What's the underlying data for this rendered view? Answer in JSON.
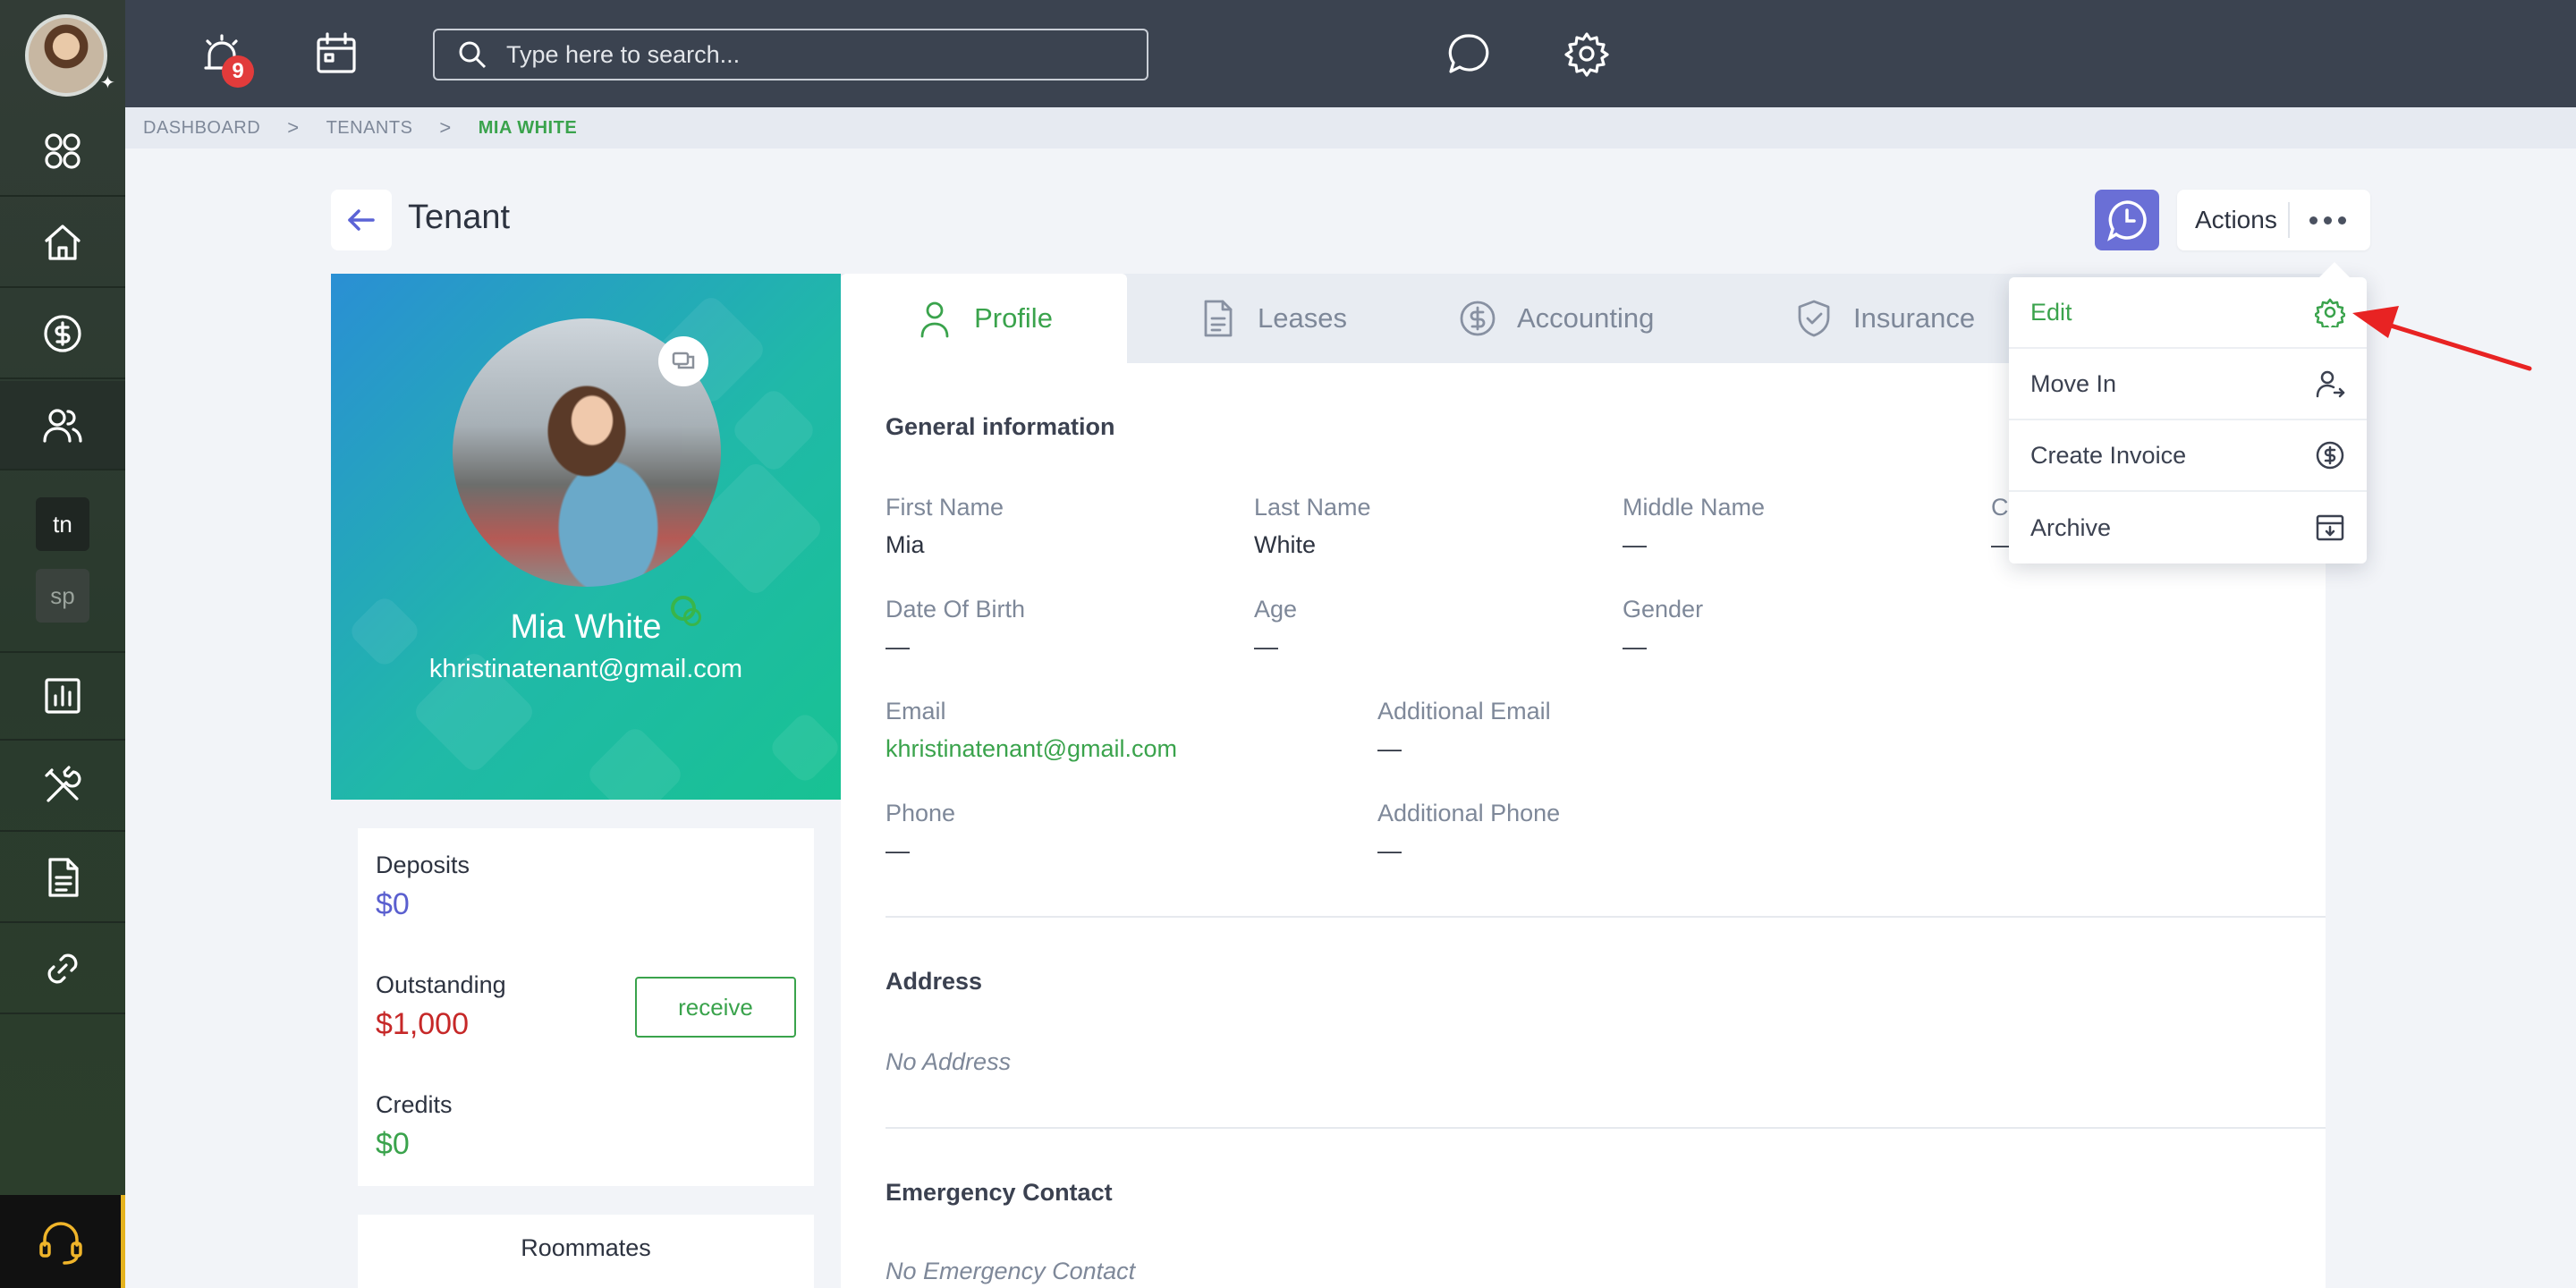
{
  "topbar": {
    "notification_count": "9",
    "search_placeholder": "Type here to search..."
  },
  "breadcrumb": {
    "items": [
      "DASHBOARD",
      "TENANTS"
    ],
    "current": "MIA WHITE",
    "separator": ">"
  },
  "header": {
    "title": "Tenant",
    "actions_label": "Actions"
  },
  "sidebar": {
    "chips": [
      "tn",
      "sp"
    ],
    "icons": [
      "apps-icon",
      "home-icon",
      "dollar-icon",
      "people-icon",
      "chart-icon",
      "tools-icon",
      "document-icon",
      "link-icon",
      "headset-icon"
    ]
  },
  "profile": {
    "name": "Mia White",
    "email": "khristinatenant@gmail.com"
  },
  "balances": {
    "deposits_label": "Deposits",
    "deposits_value": "$0",
    "outstanding_label": "Outstanding",
    "outstanding_value": "$1,000",
    "credits_label": "Credits",
    "credits_value": "$0",
    "receive_label": "receive",
    "roommates_label": "Roommates"
  },
  "tabs": [
    {
      "label": "Profile",
      "active": true
    },
    {
      "label": "Leases",
      "active": false
    },
    {
      "label": "Accounting",
      "active": false
    },
    {
      "label": "Insurance",
      "active": false
    }
  ],
  "general": {
    "title": "General information",
    "first_name_label": "First Name",
    "first_name": "Mia",
    "last_name_label": "Last Name",
    "last_name": "White",
    "middle_name_label": "Middle Name",
    "middle_name": "—",
    "partial_label": "C",
    "partial_value": "—",
    "dob_label": "Date Of Birth",
    "dob": "—",
    "age_label": "Age",
    "age": "—",
    "gender_label": "Gender",
    "gender": "—",
    "email_label": "Email",
    "email": "khristinatenant@gmail.com",
    "additional_email_label": "Additional Email",
    "additional_email": "—",
    "phone_label": "Phone",
    "phone": "—",
    "additional_phone_label": "Additional Phone",
    "additional_phone": "—"
  },
  "address": {
    "title": "Address",
    "empty": "No Address"
  },
  "emergency": {
    "title": "Emergency Contact",
    "empty": "No Emergency Contact"
  },
  "dropdown": {
    "items": [
      "Edit",
      "Move In",
      "Create Invoice",
      "Archive"
    ]
  },
  "colors": {
    "accent_green": "#3aa34c",
    "accent_purple": "#6a6fd6",
    "danger_red": "#c62828",
    "topbar_bg": "#3b4350"
  }
}
